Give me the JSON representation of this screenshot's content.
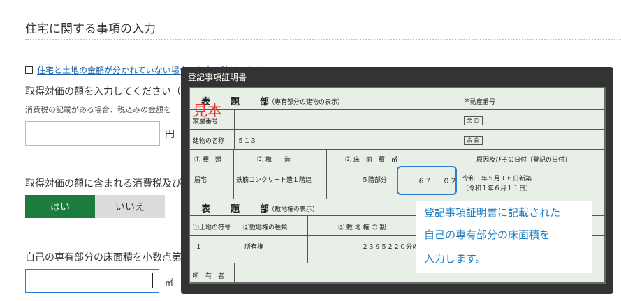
{
  "page": {
    "section_title": "住宅に関する事項の入力",
    "link_text": "住宅と土地の金額が分かれていない場合の入力方法はこちら",
    "acquisition_label": "取得対価の額を入力してください（",
    "tax_note": "消費税の記載がある場合、税込みの金額を",
    "yen_unit": "円",
    "consumption_tax_question": "取得対価の額に含まれる消費税及び",
    "yes_label": "はい",
    "no_label": "いいえ",
    "floor_area_label": "自己の専有部分の床面積を小数点第",
    "area_unit": "㎡"
  },
  "overlay": {
    "title": "登記事項証明書",
    "stamp": "見本",
    "callout_lines": [
      "登記事項証明書に記載された",
      "自己の専有部分の床面積を",
      "入力します。"
    ],
    "certificate": {
      "header1": "表　題　部",
      "header1_sub": "（専有部分の建物の表示）",
      "realty_no_label": "不動産番号",
      "blank1": "余 白",
      "blank2": "余 白",
      "house_no_label": "家屋番号",
      "building_name_label": "建物の名称",
      "building_name": "５１３",
      "col_kind": "① 種　類",
      "col_structure": "② 構　　造",
      "col_area": "③ 床　面　積　㎡",
      "col_cause": "原因及びその日付〔登記の日付〕",
      "kind": "居宅",
      "structure": "鉄筋コンクリート造１階建",
      "floor": "５階部分",
      "area_int": "６７",
      "area_dec": "０２",
      "cause_line1": "令和１年５月１６日新築",
      "cause_line2": "〔令和１年６月１１日〕",
      "header2": "表　題　部",
      "header2_sub": "（敷地権の表示）",
      "col_land_no": "①土地の符号",
      "col_right_kind": "②敷地権の種類",
      "col_ratio": "③ 敷 地 権 の 割",
      "land_no": "１",
      "right_kind": "所有権",
      "ratio": "２３９５２２０分の",
      "owner_label": "所　有　者"
    }
  }
}
